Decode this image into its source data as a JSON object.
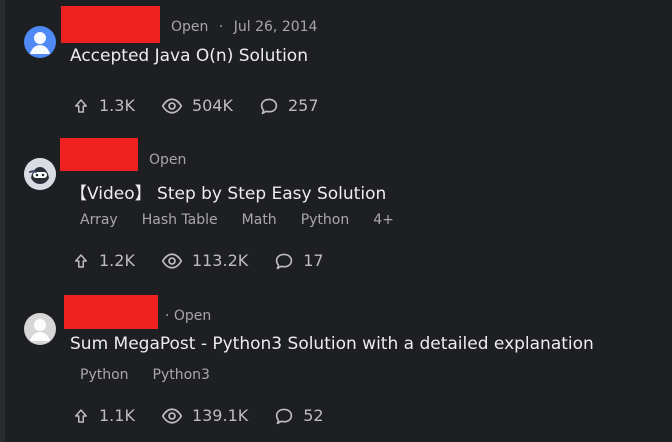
{
  "posts": [
    {
      "status": "Open",
      "date": "Jul 26, 2014",
      "title": "Accepted Java O(n) Solution",
      "tags": [],
      "stats": {
        "upvotes": "1.3K",
        "views": "504K",
        "comments": "257"
      }
    },
    {
      "status": "Open",
      "date": "",
      "title": "【Video】 Step by Step Easy Solution",
      "tags": [
        "Array",
        "Hash Table",
        "Math",
        "Python",
        "4+"
      ],
      "stats": {
        "upvotes": "1.2K",
        "views": "113.2K",
        "comments": "17"
      }
    },
    {
      "status": "· Open",
      "date": "",
      "title": "Sum MegaPost - Python3 Solution with a detailed explanation",
      "tags": [
        "Python",
        "Python3"
      ],
      "stats": {
        "upvotes": "1.1K",
        "views": "139.1K",
        "comments": "52"
      }
    }
  ],
  "separator": "·",
  "icons": {
    "upvote": "arrow-up-icon",
    "views": "eye-icon",
    "comments": "comment-icon"
  },
  "colors": {
    "background": "#1e1f22",
    "text_primary": "#ededed",
    "text_secondary": "#a6a6a6",
    "redaction": "#ef2020",
    "avatar_blue": "#4e89f4"
  }
}
